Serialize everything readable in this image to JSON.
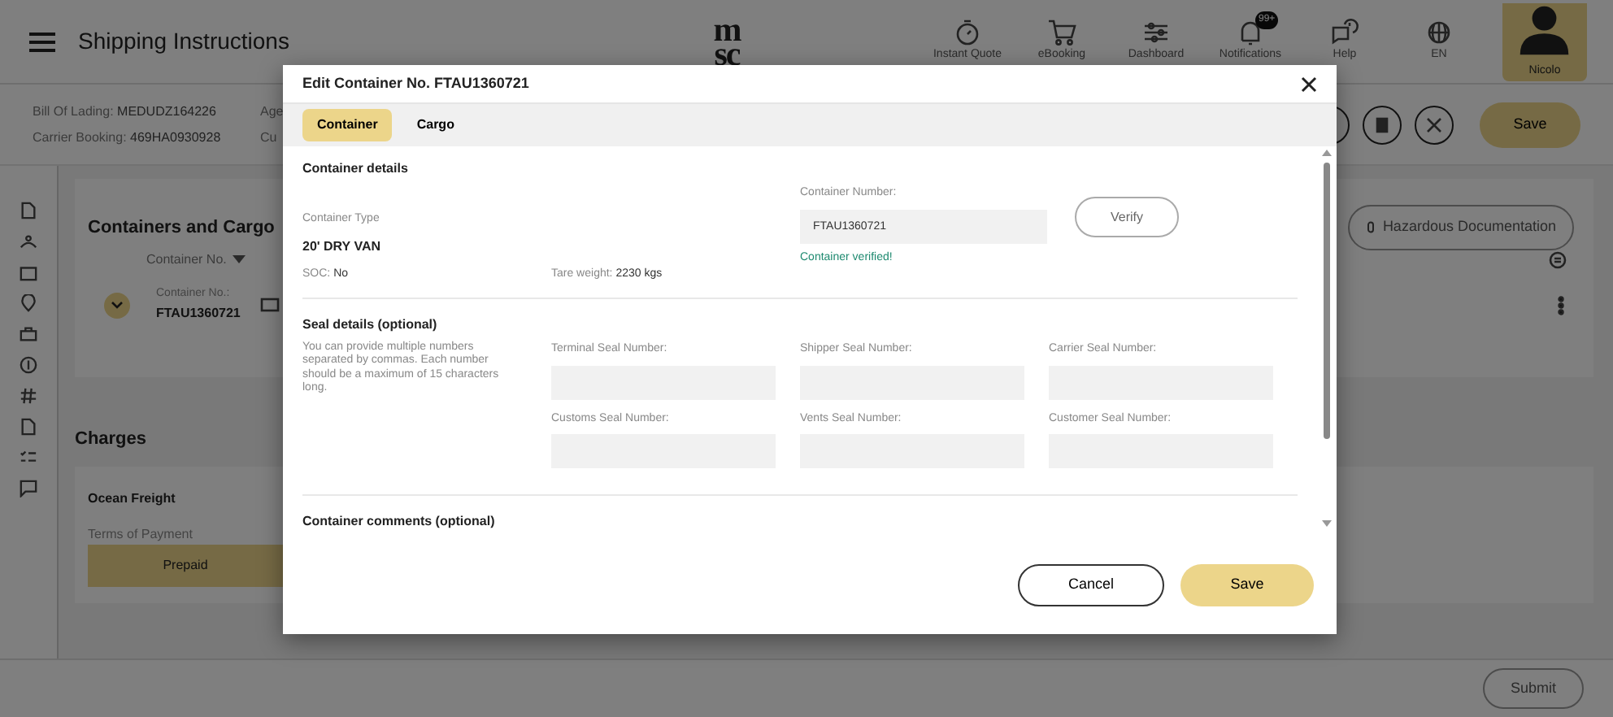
{
  "header": {
    "title": "Shipping Instructions",
    "logo": [
      "m",
      "sc"
    ],
    "nav": [
      {
        "label": "Instant Quote"
      },
      {
        "label": "eBooking"
      },
      {
        "label": "Dashboard"
      },
      {
        "label": "Notifications",
        "badge": "99+"
      },
      {
        "label": "Help"
      },
      {
        "label": "EN"
      }
    ],
    "user": "Nicolo"
  },
  "booking_info": [
    {
      "label": "Bill Of Lading:",
      "value": "MEDUDZ164226",
      "side": "Age"
    },
    {
      "label": "Carrier Booking:",
      "value": "469HA0930928",
      "side": "Cu"
    }
  ],
  "actions": {
    "save": "Save"
  },
  "containers_section": {
    "title": "Containers and Cargo",
    "hazardous_button": "Hazardous Documentation",
    "sort_column": "Container No.",
    "rows": [
      {
        "label": "Container No.:",
        "value": "FTAU1360721"
      }
    ]
  },
  "charges": {
    "title": "Charges",
    "items": [
      {
        "name": "Ocean Freight",
        "terms_label": "Terms of Payment",
        "terms": "Prepaid"
      }
    ]
  },
  "submit": "Submit",
  "modal": {
    "title": "Edit Container No. FTAU1360721",
    "tabs": [
      {
        "label": "Container",
        "selected": true
      },
      {
        "label": "Cargo",
        "selected": false
      }
    ],
    "details": {
      "title": "Container details",
      "type_label": "Container Type",
      "type": "20' DRY VAN",
      "soc_label": "SOC:",
      "soc": "No",
      "tare_label": "Tare weight:",
      "tare": "2230 kgs",
      "number_label": "Container Number:",
      "number": "FTAU1360721",
      "verified": "Container verified!",
      "verify_button": "Verify"
    },
    "seal": {
      "title": "Seal details (optional)",
      "description": "You can provide multiple numbers separated by commas. Each number should be a maximum of 15 characters long.",
      "fields": [
        {
          "label": "Terminal Seal Number:"
        },
        {
          "label": "Shipper Seal Number:"
        },
        {
          "label": "Carrier Seal Number:"
        },
        {
          "label": "Customs Seal Number:"
        },
        {
          "label": "Vents Seal Number:"
        },
        {
          "label": "Customer Seal Number:"
        }
      ]
    },
    "comments_title": "Container comments (optional)",
    "cancel": "Cancel",
    "save": "Save"
  }
}
